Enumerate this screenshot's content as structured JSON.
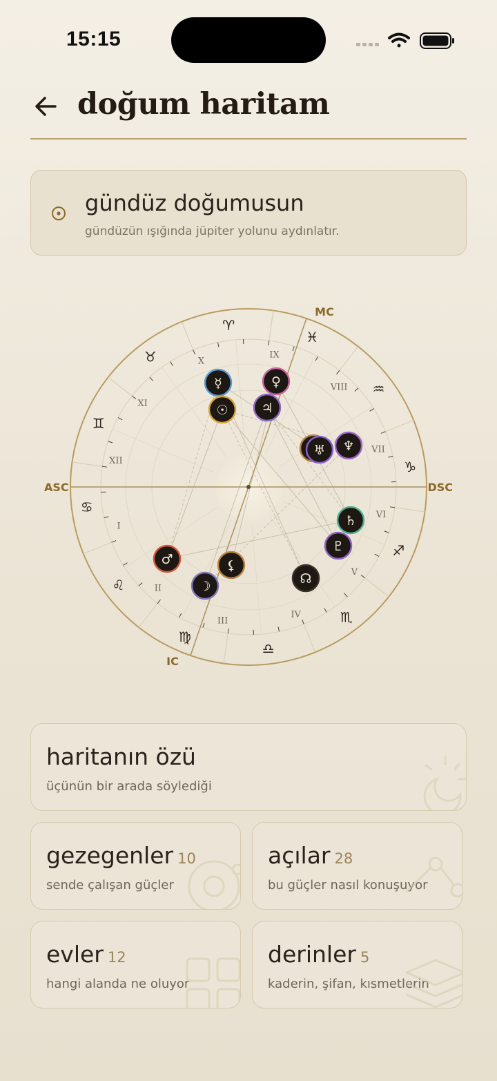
{
  "status_bar": {
    "time": "15:15"
  },
  "header": {
    "title": "doğum haritam"
  },
  "day_card": {
    "title": "gündüz doğumusun",
    "subtitle": "gündüzün ışığında jüpiter yolunu aydınlatır."
  },
  "chart": {
    "angles": {
      "mc": "MC",
      "ic": "IC",
      "asc": "ASC",
      "dsc": "DSC"
    },
    "houses": [
      "I",
      "II",
      "III",
      "IV",
      "V",
      "VI",
      "VII",
      "VIII",
      "IX",
      "X",
      "XI",
      "XII"
    ],
    "zodiac": [
      "♈",
      "♉",
      "♊",
      "♋",
      "♌",
      "♍",
      "♎",
      "♏",
      "♐",
      "♑",
      "♒",
      "♓"
    ],
    "planets": [
      {
        "name": "mercury",
        "symbol": "☿",
        "ring": "#5a9bd4"
      },
      {
        "name": "venus",
        "symbol": "♀",
        "ring": "#c9659f"
      },
      {
        "name": "sun",
        "symbol": "☉",
        "ring": "#d4a53a"
      },
      {
        "name": "jupiter",
        "symbol": "♃",
        "ring": "#8b6cc0"
      },
      {
        "name": "chiron",
        "symbol": "⚷",
        "ring": "#b98545"
      },
      {
        "name": "uranus",
        "symbol": "♅",
        "ring": "#8a5fc9"
      },
      {
        "name": "neptune",
        "symbol": "♆",
        "ring": "#9c66c4"
      },
      {
        "name": "saturn",
        "symbol": "♄",
        "ring": "#4fae91"
      },
      {
        "name": "pluto",
        "symbol": "♇",
        "ring": "#8f63bf"
      },
      {
        "name": "node",
        "symbol": "☊",
        "ring": "#3b3025"
      },
      {
        "name": "mars",
        "symbol": "♂",
        "ring": "#d0563d"
      },
      {
        "name": "lilith",
        "symbol": "⚸",
        "ring": "#b98545"
      },
      {
        "name": "moon",
        "symbol": "☽",
        "ring": "#7f74b8"
      }
    ]
  },
  "cards": {
    "essence": {
      "title": "haritanın özü",
      "subtitle": "üçünün bir arada söylediği"
    },
    "planets": {
      "title": "gezegenler",
      "count": "10",
      "subtitle": "sende çalışan güçler"
    },
    "aspects": {
      "title": "açılar",
      "count": "28",
      "subtitle": "bu güçler nasıl konuşuyor"
    },
    "houses": {
      "title": "evler",
      "count": "12",
      "subtitle": "hangi alanda ne oluyor"
    },
    "depths": {
      "title": "derinler",
      "count": "5",
      "subtitle": "kaderin, şifan, kısmetlerin"
    }
  },
  "colors": {
    "accent": "#b6a275",
    "background": "#efe9dc",
    "text": "#2a221b"
  }
}
